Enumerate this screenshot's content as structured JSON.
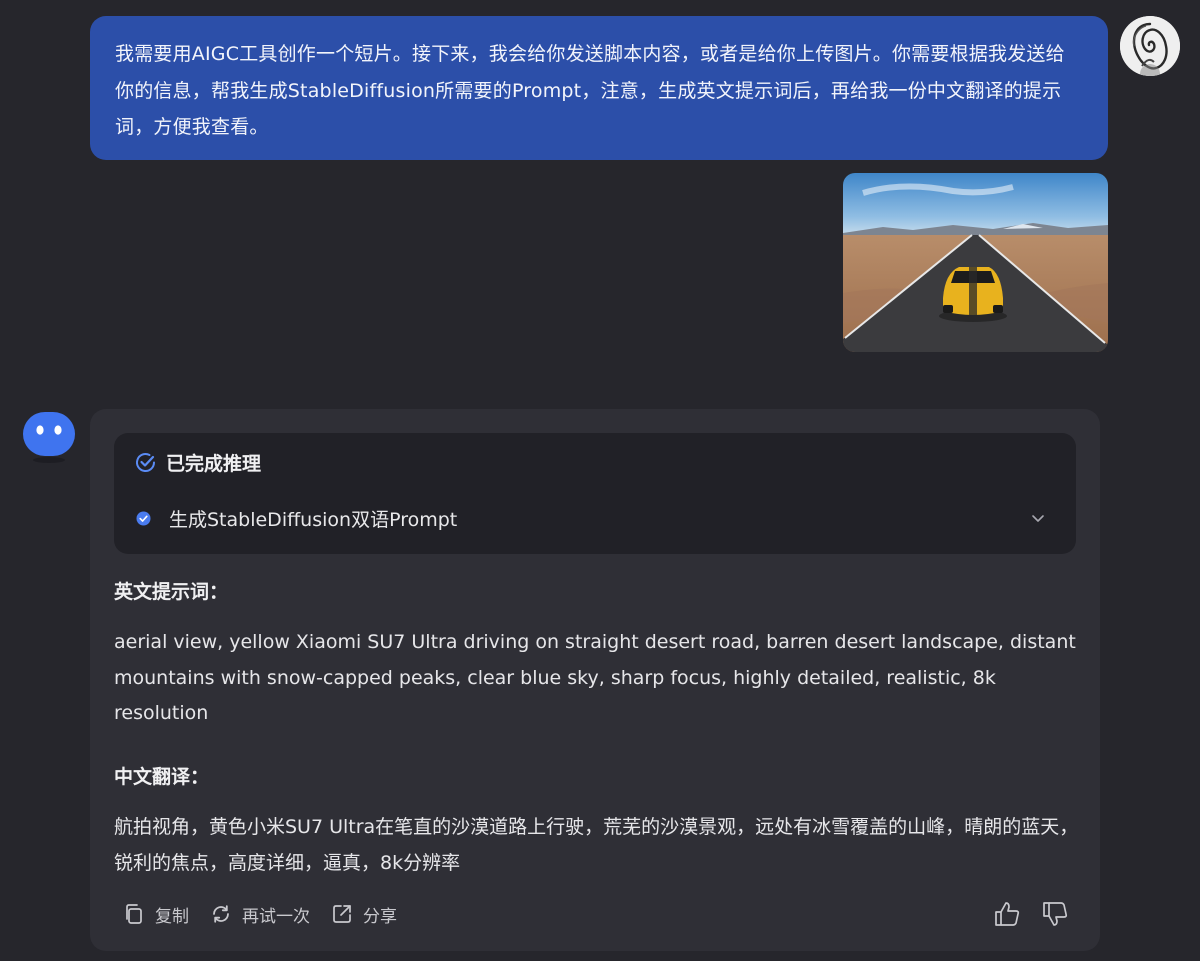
{
  "user": {
    "message": "我需要用AIGC工具创作一个短片。接下来，我会给你发送脚本内容，或者是给你上传图片。你需要根据我发送给你的信息，帮我生成StableDiffusion所需要的Prompt，注意，生成英文提示词后，再给我一份中文翻译的提示词，方便我查看。",
    "avatar_icon": "user-avatar-icon",
    "image_icon": "uploaded-car-photo"
  },
  "bot": {
    "avatar_icon": "bot-avatar-icon",
    "reasoning": {
      "status": "已完成推理",
      "step": "生成StableDiffusion双语Prompt"
    },
    "english_heading": "英文提示词：",
    "english_body": "aerial view, yellow Xiaomi SU7 Ultra driving on straight desert road, barren desert landscape, distant mountains with snow-capped peaks, clear blue sky, sharp focus, highly detailed, realistic, 8k resolution",
    "chinese_heading": "中文翻译：",
    "chinese_body": "航拍视角，黄色小米SU7 Ultra在笔直的沙漠道路上行驶，荒芜的沙漠景观，远处有冰雪覆盖的山峰，晴朗的蓝天，锐利的焦点，高度详细，逼真，8k分辨率",
    "actions": {
      "copy": "复制",
      "retry": "再试一次",
      "share": "分享"
    }
  },
  "colors": {
    "background": "#26262c",
    "user_bubble": "#2c4fa9",
    "bot_card": "#2f2f36",
    "reasoning_box": "#212127",
    "accent": "#4a7cf0"
  }
}
